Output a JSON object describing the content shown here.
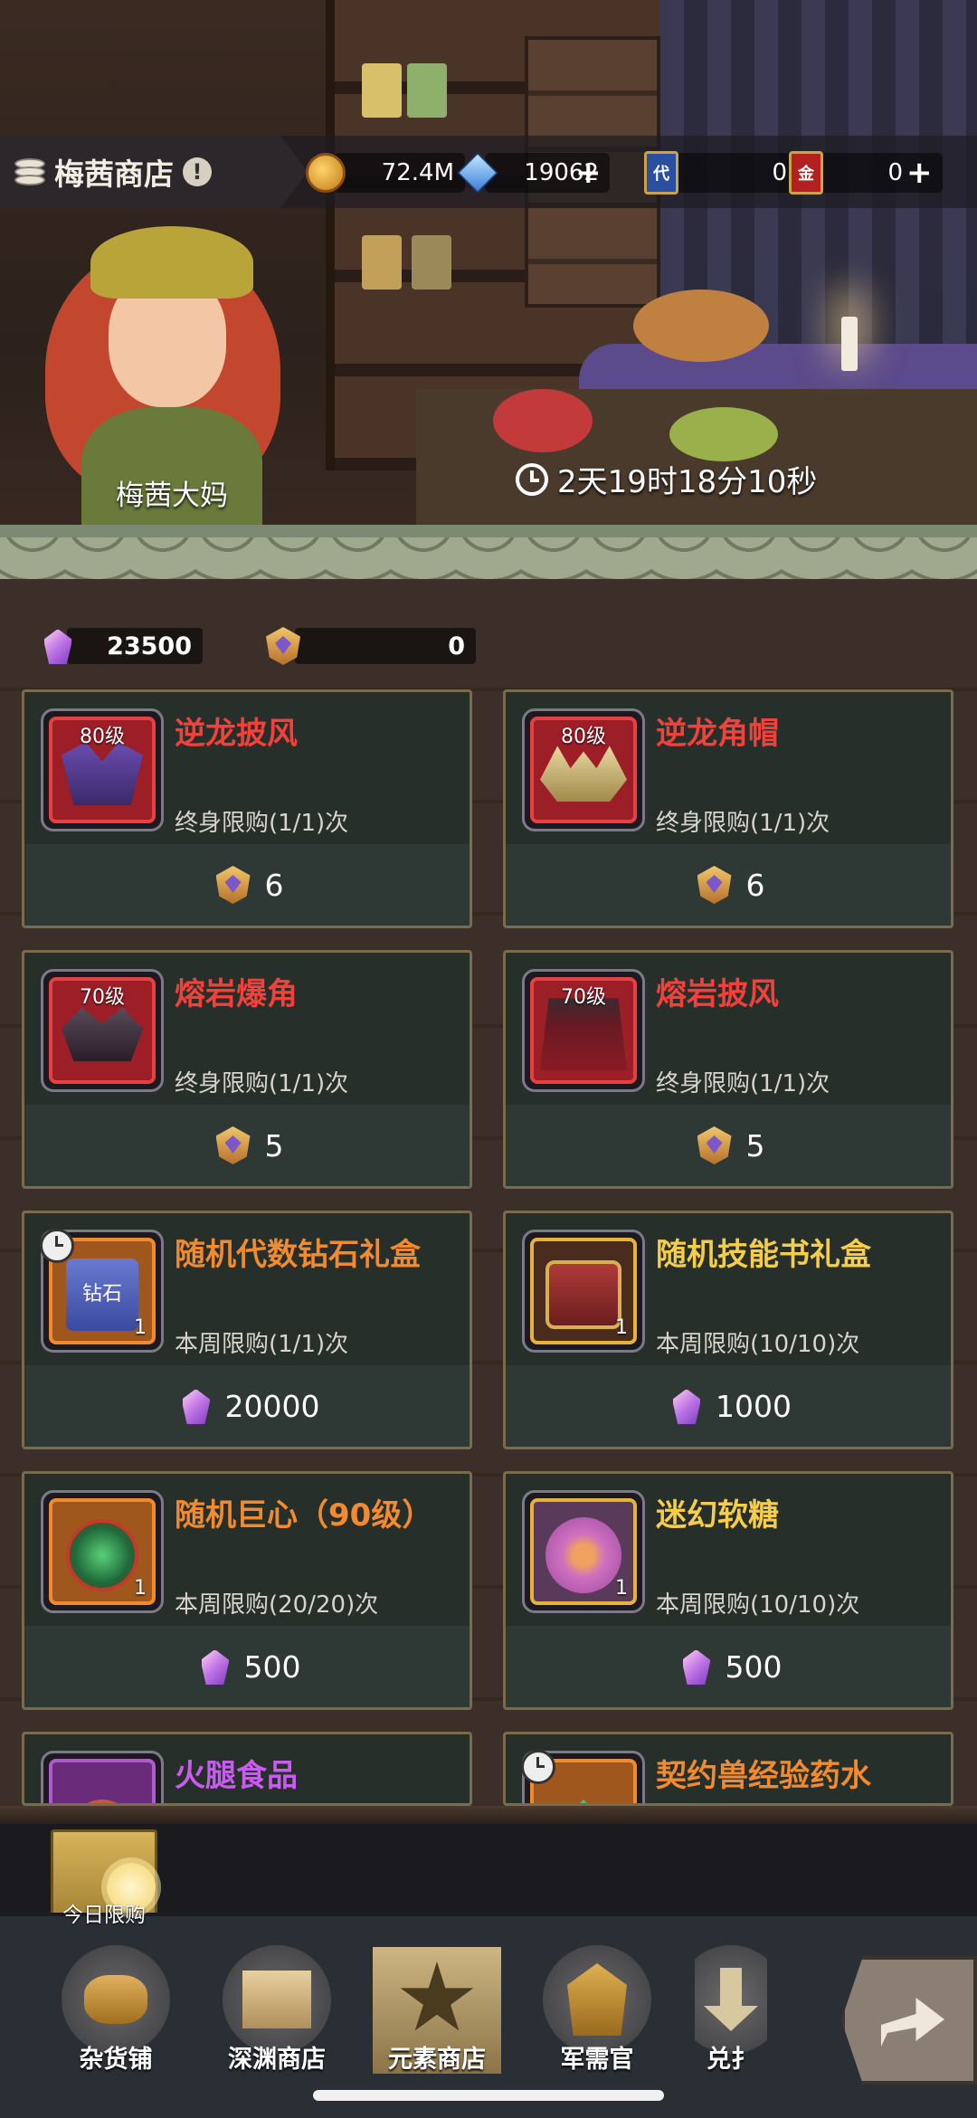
{
  "header": {
    "shop_title": "梅茜商店",
    "info_icon": "!",
    "resources": [
      {
        "icon": "gold-coin-icon",
        "value": "72.4M"
      },
      {
        "icon": "blue-crystal-icon",
        "value": "19062",
        "has_plus": true
      },
      {
        "icon": "red-card-代-icon",
        "label": "代",
        "value": "0"
      },
      {
        "icon": "red-card-金-icon",
        "label": "金",
        "value": "0",
        "has_plus": true
      }
    ],
    "plus": "+"
  },
  "scene": {
    "npc_name": "梅茜大妈",
    "refresh_timer": "2天19时18分10秒"
  },
  "currencies": [
    {
      "icon": "pink-crystal-icon",
      "value": "23500"
    },
    {
      "icon": "medal-badge-icon",
      "value": "0"
    }
  ],
  "items": [
    {
      "name": "逆龙披风",
      "name_color": "#f2403a",
      "level": "80级",
      "limit": "终身限购(1/1)次",
      "price_icon": "medal-badge-icon",
      "price": "6",
      "frame": "red",
      "qty": ""
    },
    {
      "name": "逆龙角帽",
      "name_color": "#f2403a",
      "level": "80级",
      "limit": "终身限购(1/1)次",
      "price_icon": "medal-badge-icon",
      "price": "6",
      "frame": "red",
      "qty": ""
    },
    {
      "name": "熔岩爆角",
      "name_color": "#f2403a",
      "level": "70级",
      "limit": "终身限购(1/1)次",
      "price_icon": "medal-badge-icon",
      "price": "5",
      "frame": "red",
      "qty": ""
    },
    {
      "name": "熔岩披风",
      "name_color": "#f2403a",
      "level": "70级",
      "limit": "终身限购(1/1)次",
      "price_icon": "medal-badge-icon",
      "price": "5",
      "frame": "red",
      "qty": ""
    },
    {
      "name": "随机代数钻石礼盒",
      "name_color": "#f28a30",
      "level": "",
      "limit": "本周限购(1/1)次",
      "price_icon": "pink-crystal-icon",
      "price": "20000",
      "frame": "orange",
      "qty": "1",
      "art_label": "钻石",
      "timed": true
    },
    {
      "name": "随机技能书礼盒",
      "name_color": "#f5cd4a",
      "level": "",
      "limit": "本周限购(10/10)次",
      "price_icon": "pink-crystal-icon",
      "price": "1000",
      "frame": "gold",
      "qty": "1"
    },
    {
      "name": "随机巨心（90级）",
      "name_color": "#f28a30",
      "level": "",
      "limit": "本周限购(20/20)次",
      "price_icon": "pink-crystal-icon",
      "price": "500",
      "frame": "orange",
      "qty": "1"
    },
    {
      "name": "迷幻软糖",
      "name_color": "#f5cd4a",
      "level": "",
      "limit": "本周限购(10/10)次",
      "price_icon": "pink-crystal-icon",
      "price": "500",
      "frame": "gold",
      "qty": "1"
    },
    {
      "name": "火腿食品",
      "name_color": "#c95cf0",
      "frame": "purple"
    },
    {
      "name": "契约兽经验药水",
      "name_color": "#f28a30",
      "frame": "orange",
      "timed": true
    }
  ],
  "daily_limit_button": "今日限购",
  "tabs": [
    {
      "label": "杂货铺",
      "icon": "coin-stack-icon"
    },
    {
      "label": "深渊商店",
      "icon": "crate-icon"
    },
    {
      "label": "元素商店",
      "icon": "element-star-icon",
      "active": true
    },
    {
      "label": "军需官",
      "icon": "helmet-icon"
    },
    {
      "label": "兑扌",
      "icon": "exchange-icon"
    }
  ]
}
